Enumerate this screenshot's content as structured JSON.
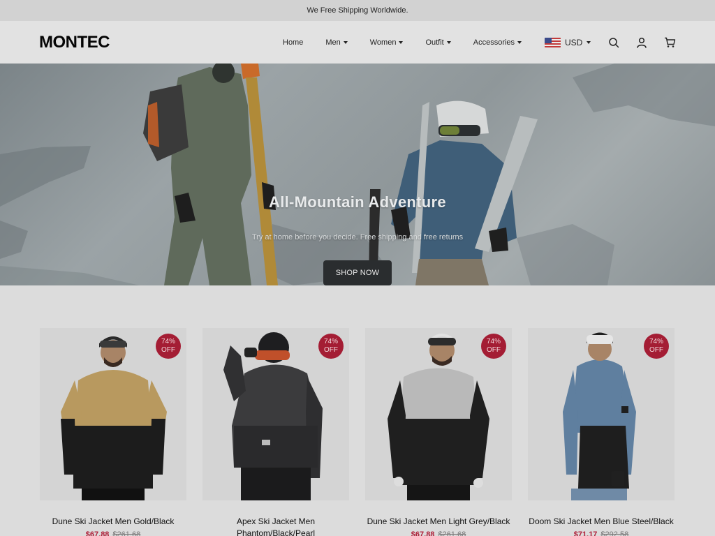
{
  "announcement": "We Free Shipping Worldwide.",
  "header": {
    "logo": "MONTEC",
    "nav": [
      {
        "label": "Home",
        "dropdown": false
      },
      {
        "label": "Men",
        "dropdown": true
      },
      {
        "label": "Women",
        "dropdown": true
      },
      {
        "label": "Outfit",
        "dropdown": true
      },
      {
        "label": "Accessories",
        "dropdown": true
      }
    ],
    "currency": "USD",
    "icons": [
      "search-icon",
      "account-icon",
      "cart-icon"
    ]
  },
  "hero": {
    "title": "All-Mountain Adventure",
    "subtitle": "Try at home before you decide. Free shipping and free returns",
    "button": "SHOP NOW"
  },
  "products": [
    {
      "title": "Dune Ski Jacket Men Gold/Black",
      "badge_pct": "74%",
      "badge_off": "OFF",
      "price": "$67.88",
      "original": "$261.68",
      "jacket_top": "#b8995f",
      "jacket_bottom": "#1c1c1c"
    },
    {
      "title": "Apex Ski Jacket Men Phantom/Black/Pearl",
      "badge_pct": "74%",
      "badge_off": "OFF",
      "price": "",
      "original": "",
      "jacket_top": "#3b3b3d",
      "jacket_bottom": "#2a2a2c"
    },
    {
      "title": "Dune Ski Jacket Men Light Grey/Black",
      "badge_pct": "74%",
      "badge_off": "OFF",
      "price": "$67.88",
      "original": "$261.68",
      "jacket_top": "#b9b9b9",
      "jacket_bottom": "#1f1f1f"
    },
    {
      "title": "Doom Ski Jacket Men Blue Steel/Black",
      "badge_pct": "74%",
      "badge_off": "OFF",
      "price": "$71.17",
      "original": "$292.58",
      "jacket_top": "#5f7f9f",
      "jacket_bottom": "#1e1e1e"
    }
  ]
}
